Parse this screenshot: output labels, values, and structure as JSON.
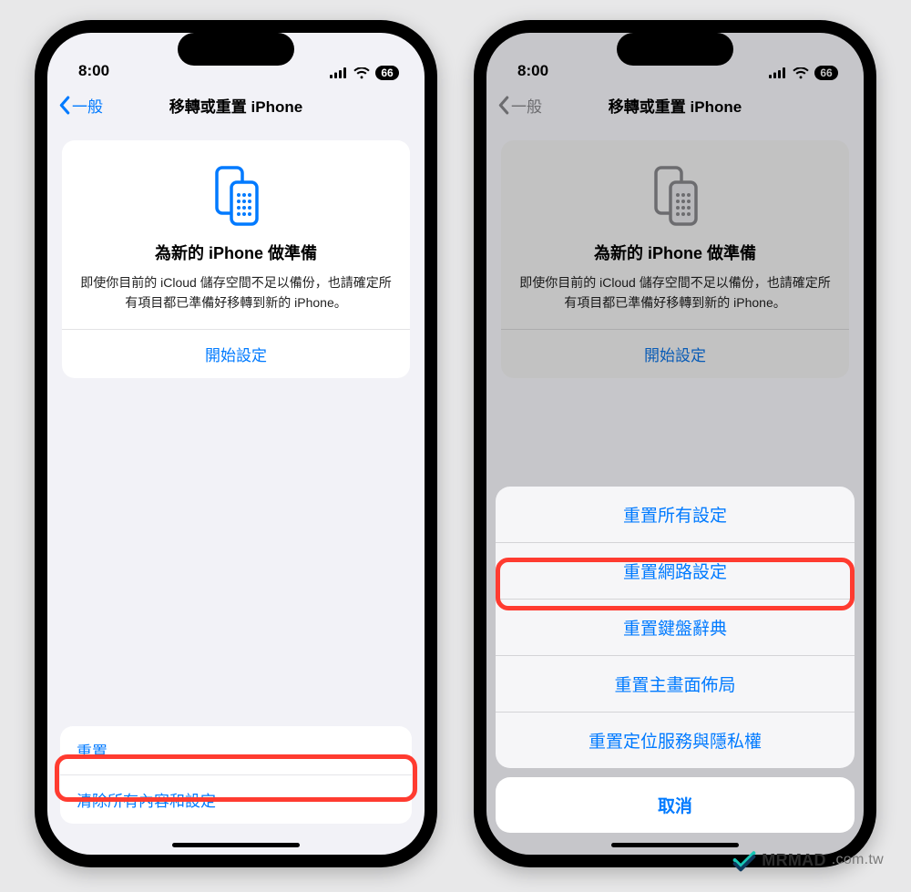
{
  "status": {
    "time": "8:00",
    "battery": "66"
  },
  "nav": {
    "back": "一般",
    "title": "移轉或重置 iPhone"
  },
  "hero": {
    "heading": "為新的 iPhone 做準備",
    "body": "即使你目前的 iCloud 儲存空間不足以備份，也請確定所有項目都已準備好移轉到新的 iPhone。",
    "cta": "開始設定"
  },
  "bottom": {
    "reset": "重置",
    "erase": "清除所有內容和設定"
  },
  "sheet": {
    "options": [
      "重置所有設定",
      "重置網路設定",
      "重置鍵盤辭典",
      "重置主畫面佈局",
      "重置定位服務與隱私權"
    ],
    "cancel": "取消"
  },
  "watermark": {
    "brand": "MRMAD",
    "domain": ".com.tw"
  }
}
